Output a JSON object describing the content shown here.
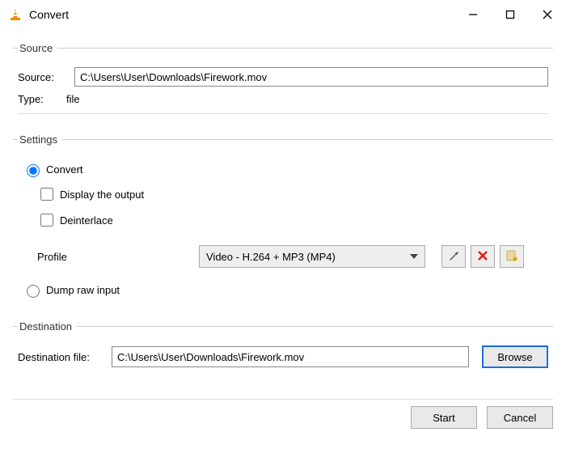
{
  "window": {
    "title": "Convert"
  },
  "source_group": {
    "legend": "Source",
    "source_label": "Source:",
    "source_value": "C:\\Users\\User\\Downloads\\Firework.mov",
    "type_label": "Type:",
    "type_value": "file"
  },
  "settings_group": {
    "legend": "Settings",
    "convert_label": "Convert",
    "display_output_label": "Display the output",
    "deinterlace_label": "Deinterlace",
    "profile_label": "Profile",
    "profile_value": "Video - H.264 + MP3 (MP4)",
    "dump_raw_label": "Dump raw input"
  },
  "destination_group": {
    "legend": "Destination",
    "dest_label": "Destination file:",
    "dest_value": "C:\\Users\\User\\Downloads\\Firework.mov",
    "browse_label": "Browse"
  },
  "footer": {
    "start_label": "Start",
    "cancel_label": "Cancel"
  }
}
